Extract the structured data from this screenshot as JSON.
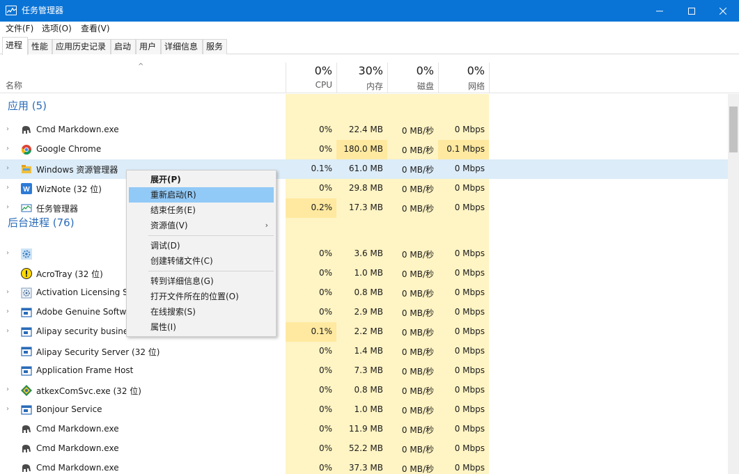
{
  "window": {
    "title": "任务管理器"
  },
  "menubar": [
    "文件(F)",
    "选项(O)",
    "查看(V)"
  ],
  "tabs": [
    "进程",
    "性能",
    "应用历史记录",
    "启动",
    "用户",
    "详细信息",
    "服务"
  ],
  "header": {
    "name_label": "名称",
    "cpu": {
      "pct": "0%",
      "label": "CPU"
    },
    "mem": {
      "pct": "30%",
      "label": "内存"
    },
    "disk": {
      "pct": "0%",
      "label": "磁盘"
    },
    "net": {
      "pct": "0%",
      "label": "网络"
    }
  },
  "groups": {
    "apps": "应用 (5)",
    "background": "后台进程 (76)"
  },
  "apps": [
    {
      "name": "Cmd Markdown.exe",
      "cpu": "0%",
      "mem": "22.4 MB",
      "disk": "0 MB/秒",
      "net": "0 Mbps",
      "icon": "elephant-icon"
    },
    {
      "name": "Google Chrome",
      "cpu": "0%",
      "mem": "180.0 MB",
      "disk": "0 MB/秒",
      "net": "0.1 Mbps",
      "icon": "chrome-icon"
    },
    {
      "name": "Windows 资源管理器",
      "cpu": "0.1%",
      "mem": "61.0 MB",
      "disk": "0 MB/秒",
      "net": "0 Mbps",
      "icon": "folder-icon"
    },
    {
      "name": "WizNote (32 位)",
      "cpu": "0%",
      "mem": "29.8 MB",
      "disk": "0 MB/秒",
      "net": "0 Mbps",
      "icon": "wiznote-icon"
    },
    {
      "name": "任务管理器",
      "cpu": "0.2%",
      "mem": "17.3 MB",
      "disk": "0 MB/秒",
      "net": "0 Mbps",
      "icon": "task-manager-icon"
    }
  ],
  "background": [
    {
      "name": "",
      "cpu": "0%",
      "mem": "3.6 MB",
      "disk": "0 MB/秒",
      "net": "0 Mbps",
      "icon": "gear-icon"
    },
    {
      "name": "AcroTray (32 位)",
      "cpu": "0%",
      "mem": "1.0 MB",
      "disk": "0 MB/秒",
      "net": "0 Mbps",
      "icon": "acrotray-icon"
    },
    {
      "name": "Activation Licensing Se",
      "cpu": "0%",
      "mem": "0.8 MB",
      "disk": "0 MB/秒",
      "net": "0 Mbps",
      "icon": "service-gear-icon"
    },
    {
      "name": "Adobe Genuine Softwa",
      "cpu": "0%",
      "mem": "2.9 MB",
      "disk": "0 MB/秒",
      "net": "0 Mbps",
      "icon": "window-app-icon"
    },
    {
      "name": "Alipay security busines",
      "cpu": "0.1%",
      "mem": "2.2 MB",
      "disk": "0 MB/秒",
      "net": "0 Mbps",
      "icon": "window-app-icon"
    },
    {
      "name": "Alipay Security Server (32 位)",
      "cpu": "0%",
      "mem": "1.4 MB",
      "disk": "0 MB/秒",
      "net": "0 Mbps",
      "icon": "window-app-icon"
    },
    {
      "name": "Application Frame Host",
      "cpu": "0%",
      "mem": "7.3 MB",
      "disk": "0 MB/秒",
      "net": "0 Mbps",
      "icon": "window-app-icon"
    },
    {
      "name": "atkexComSvc.exe (32 位)",
      "cpu": "0%",
      "mem": "0.8 MB",
      "disk": "0 MB/秒",
      "net": "0 Mbps",
      "icon": "diamond-icon"
    },
    {
      "name": "Bonjour Service",
      "cpu": "0%",
      "mem": "1.0 MB",
      "disk": "0 MB/秒",
      "net": "0 Mbps",
      "icon": "window-app-icon"
    },
    {
      "name": "Cmd Markdown.exe",
      "cpu": "0%",
      "mem": "11.9 MB",
      "disk": "0 MB/秒",
      "net": "0 Mbps",
      "icon": "elephant-icon"
    },
    {
      "name": "Cmd Markdown.exe",
      "cpu": "0%",
      "mem": "52.2 MB",
      "disk": "0 MB/秒",
      "net": "0 Mbps",
      "icon": "elephant-icon"
    },
    {
      "name": "Cmd Markdown.exe",
      "cpu": "0%",
      "mem": "37.3 MB",
      "disk": "0 MB/秒",
      "net": "0 Mbps",
      "icon": "elephant-icon"
    }
  ],
  "context_menu": [
    {
      "label": "展开(P)",
      "bold": true
    },
    {
      "label": "重新启动(R)",
      "hover": true
    },
    {
      "label": "结束任务(E)"
    },
    {
      "label": "资源值(V)",
      "submenu": true
    },
    {
      "sep": true
    },
    {
      "label": "调试(D)"
    },
    {
      "label": "创建转储文件(C)"
    },
    {
      "sep": true
    },
    {
      "label": "转到详细信息(G)"
    },
    {
      "label": "打开文件所在的位置(O)"
    },
    {
      "label": "在线搜索(S)"
    },
    {
      "label": "属性(I)"
    }
  ],
  "colors": {
    "titlebar": "#0a74d6",
    "heat": "#fff4c4",
    "heat_strong": "#ffe9a0",
    "selected_row": "#dcecf8",
    "menu_hover": "#91c9f7",
    "group_text": "#2a6bb8"
  }
}
